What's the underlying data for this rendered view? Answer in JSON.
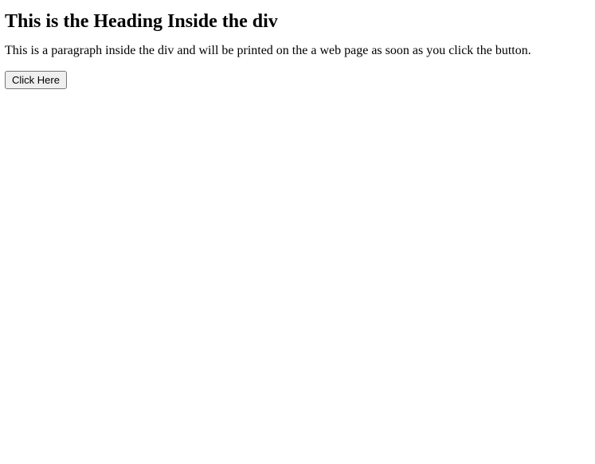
{
  "heading": "This is the Heading Inside the div",
  "paragraph": "This is a paragraph inside the div and will be printed on the a web page as soon as you click the button.",
  "button_label": "Click Here"
}
